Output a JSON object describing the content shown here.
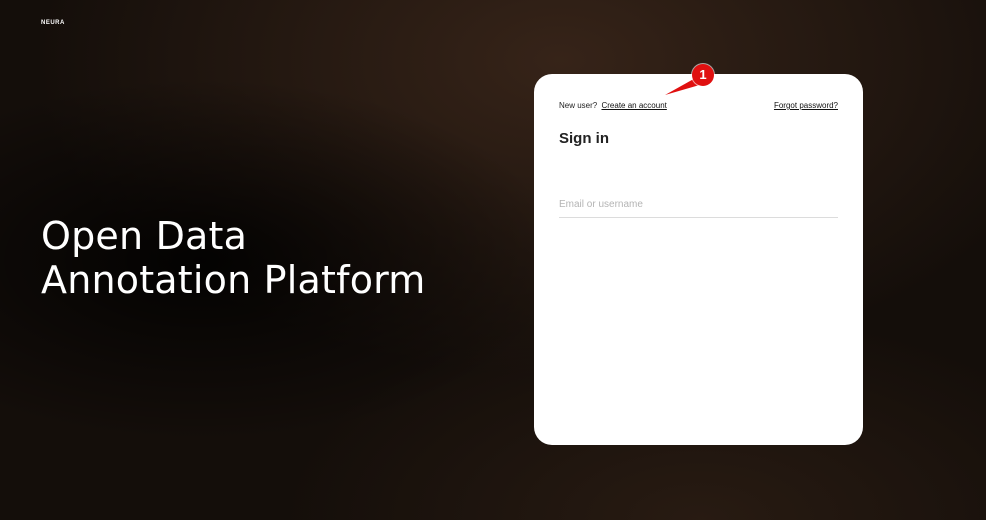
{
  "brand": {
    "logo_text": "NEURA"
  },
  "hero": {
    "line1": "Open Data",
    "line2": "Annotation Platform"
  },
  "signin_card": {
    "new_user_text": "New user?",
    "create_account_link": "Create an account",
    "forgot_password_link": "Forgot password?",
    "title": "Sign in",
    "email_field": {
      "value": "",
      "placeholder": "Email or username"
    }
  },
  "annotation": {
    "badge_number": "1",
    "color": "#e01010"
  }
}
